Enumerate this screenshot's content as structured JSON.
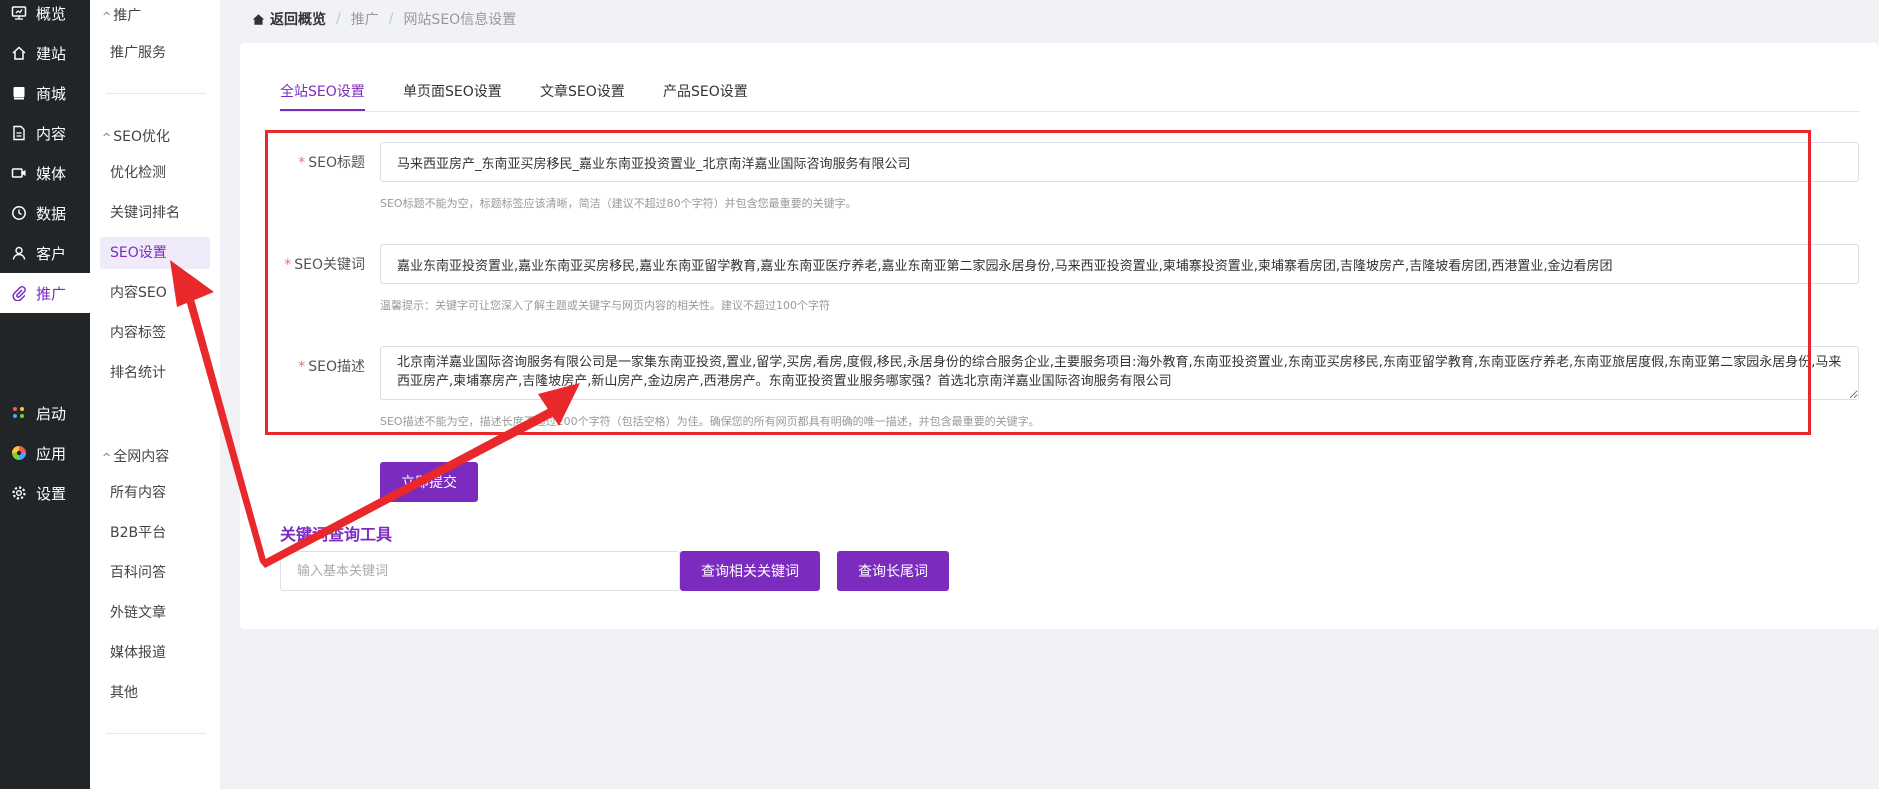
{
  "nav": {
    "items": [
      {
        "label": "概览",
        "icon": "overview-icon"
      },
      {
        "label": "建站",
        "icon": "home-icon"
      },
      {
        "label": "商城",
        "icon": "shop-icon"
      },
      {
        "label": "内容",
        "icon": "document-icon"
      },
      {
        "label": "媒体",
        "icon": "video-icon"
      },
      {
        "label": "数据",
        "icon": "clock-icon"
      },
      {
        "label": "客户",
        "icon": "user-icon"
      },
      {
        "label": "推广",
        "icon": "paperclip-icon",
        "active": true
      }
    ],
    "bottom_items": [
      {
        "label": "启动",
        "icon": "dots-icon"
      },
      {
        "label": "应用",
        "icon": "colorwheel-icon"
      },
      {
        "label": "设置",
        "icon": "gear-icon"
      }
    ]
  },
  "submenu": {
    "group1": {
      "title": "推广",
      "items": [
        "推广服务"
      ]
    },
    "group2": {
      "title": "SEO优化",
      "items": [
        "优化检测",
        "关键词排名",
        "SEO设置",
        "内容SEO",
        "内容标签",
        "排名统计"
      ],
      "active": "SEO设置"
    },
    "group3": {
      "title": "全网内容",
      "items": [
        "所有内容",
        "B2B平台",
        "百科问答",
        "外链文章",
        "媒体报道",
        "其他"
      ]
    }
  },
  "breadcrumb": {
    "home": "返回概览",
    "level1": "推广",
    "level2": "网站SEO信息设置"
  },
  "tabs": [
    "全站SEO设置",
    "单页面SEO设置",
    "文章SEO设置",
    "产品SEO设置"
  ],
  "active_tab": "全站SEO设置",
  "form": {
    "title": {
      "label": "SEO标题",
      "value": "马来西亚房产_东南亚买房移民_嘉业东南亚投资置业_北京南洋嘉业国际咨询服务有限公司",
      "hint": "SEO标题不能为空，标题标签应该清晰，简洁（建议不超过80个字符）并包含您最重要的关键字。"
    },
    "keywords": {
      "label": "SEO关键词",
      "value": "嘉业东南亚投资置业,嘉业东南亚买房移民,嘉业东南亚留学教育,嘉业东南亚医疗养老,嘉业东南亚第二家园永居身份,马来西亚投资置业,柬埔寨投资置业,柬埔寨看房团,吉隆坡房产,吉隆坡看房团,西港置业,金边看房团",
      "hint": "温馨提示：关键字可让您深入了解主题或关键字与网页内容的相关性。建议不超过100个字符"
    },
    "description": {
      "label": "SEO描述",
      "value": "北京南洋嘉业国际咨询服务有限公司是一家集东南亚投资,置业,留学,买房,看房,度假,移民,永居身份的综合服务企业,主要服务项目:海外教育,东南亚投资置业,东南亚买房移民,东南亚留学教育,东南亚医疗养老,东南亚旅居度假,东南亚第二家园永居身份,马来西亚房产,柬埔寨房产,吉隆坡房产,新山房产,金边房产,西港房产。东南亚投资置业服务哪家强？首选北京南洋嘉业国际咨询服务有限公司",
      "hint": "SEO描述不能为空，描述长度不超过200个字符（包括空格）为佳。确保您的所有网页都具有明确的唯一描述，并包含最重要的关键字。"
    },
    "submit_label": "立即提交"
  },
  "keyword_tool": {
    "title": "关键词查询工具",
    "placeholder": "输入基本关键词",
    "related_button": "查询相关关键词",
    "longtail_button": "查询长尾词"
  },
  "colors": {
    "accent": "#7b2cbf",
    "annotation": "#e8282b",
    "nav_bg": "#222527"
  }
}
